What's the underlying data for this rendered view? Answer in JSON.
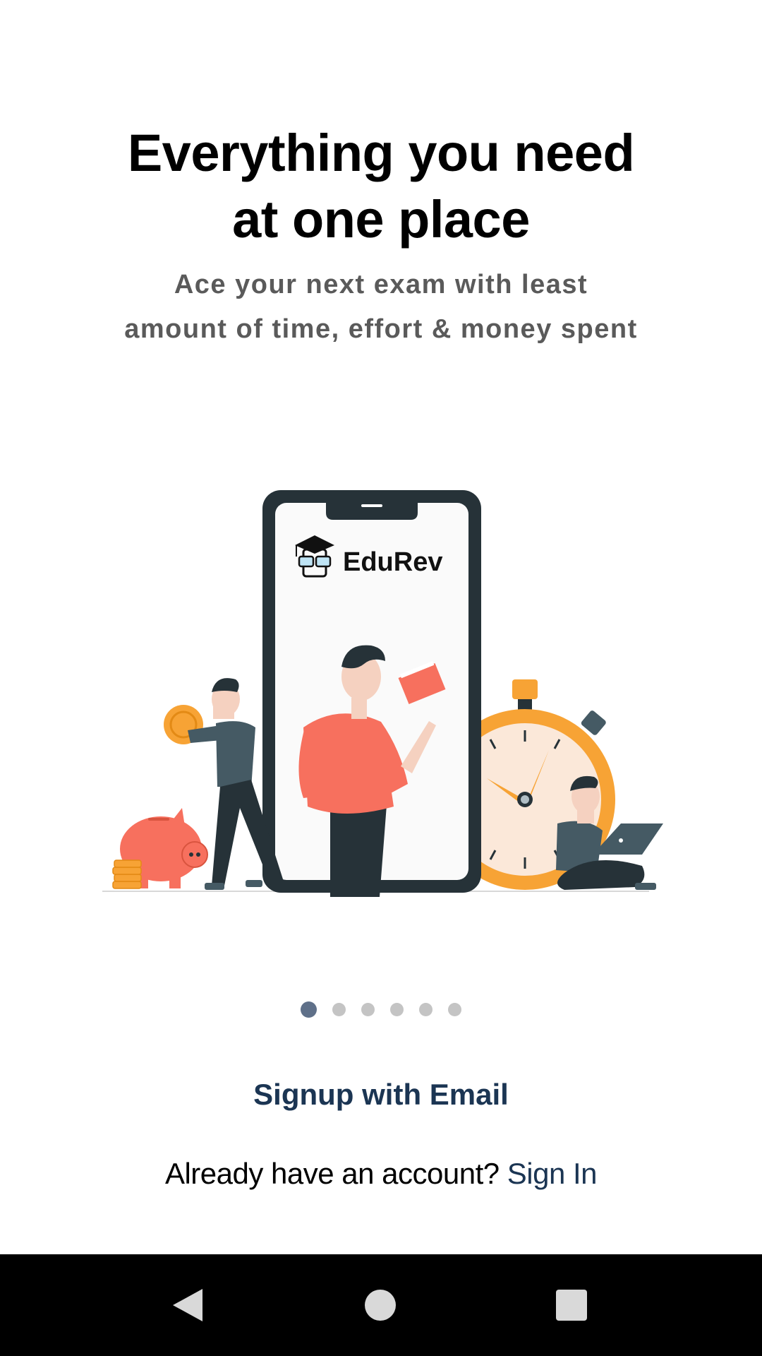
{
  "onboarding": {
    "title_line1": "Everything you need",
    "title_line2": "at one place",
    "subtitle_line1": "Ace your next exam with least",
    "subtitle_line2": "amount of time, effort & money spent",
    "illustration_brand": "EduRev",
    "pager": {
      "total": 6,
      "active_index": 0
    }
  },
  "actions": {
    "signup_label": "Signup with Email",
    "signin_prompt": "Already have an account?",
    "signin_label": "Sign In"
  },
  "colors": {
    "accent": "#1b3553",
    "dot_active": "#5f7089",
    "dot_inactive": "#c4c4c4",
    "illustration_orange": "#f7a335",
    "illustration_coral": "#f7705e",
    "illustration_dark": "#263238"
  },
  "system_nav": {
    "back_icon": "back-triangle-icon",
    "home_icon": "home-circle-icon",
    "recents_icon": "recents-square-icon"
  }
}
